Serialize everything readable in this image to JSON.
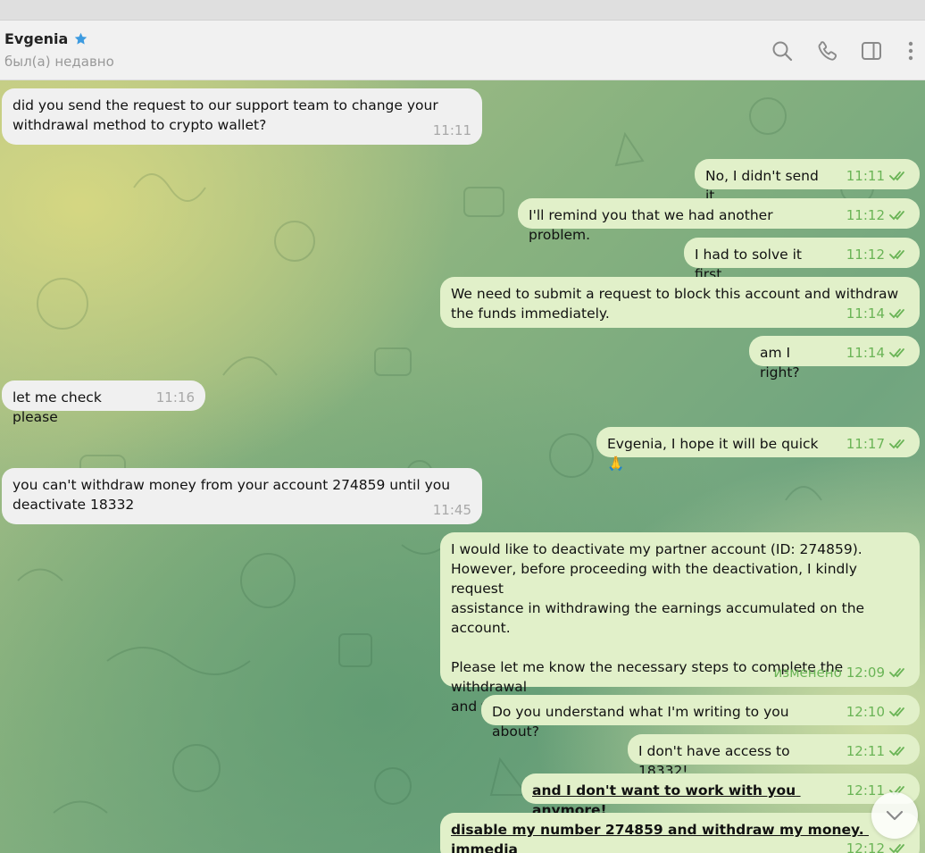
{
  "header": {
    "contact_name": "Evgenia",
    "status": "был(а) недавно",
    "icons": [
      "star-icon",
      "search-icon",
      "phone-icon",
      "sidebar-toggle-icon",
      "more-icon"
    ]
  },
  "messages": [
    {
      "side": "in",
      "text": "did you send the request to our support team to change your\nwithdrawal method to crypto wallet?",
      "time": "11:11"
    },
    {
      "side": "out",
      "text": "No, I didn't send it.",
      "time": "11:11"
    },
    {
      "side": "out",
      "text": "I'll remind you that we had another problem.",
      "time": "11:12"
    },
    {
      "side": "out",
      "text": "I had to solve it first.",
      "time": "11:12"
    },
    {
      "side": "out",
      "text": "We need to submit a request to block this account and withdraw\nthe funds immediately.",
      "time": "11:14"
    },
    {
      "side": "out",
      "text": "am I right?",
      "time": "11:14"
    },
    {
      "side": "in",
      "text": "let me check please",
      "time": "11:16"
    },
    {
      "side": "out",
      "text": "Evgenia, I hope it will be quick 🙏",
      "time": "11:17"
    },
    {
      "side": "in",
      "text": "you can't withdraw money from your account 274859 until you\ndeactivate 18332",
      "time": "11:45"
    },
    {
      "side": "out",
      "text": "I would like to deactivate my partner account (ID: 274859).\nHowever, before proceeding with the deactivation, I kindly request\nassistance in withdrawing the earnings accumulated on the\naccount.\n\nPlease let me know the necessary steps to complete the withdrawal\nand finalize the deactivation process.",
      "edited_label": "изменено",
      "time": "12:09"
    },
    {
      "side": "out",
      "text": "Do you understand what I'm writing to you about?",
      "time": "12:10"
    },
    {
      "side": "out",
      "text": "I don't have access to 18332!",
      "time": "12:11"
    },
    {
      "side": "out",
      "text": "and I don't want to work with you anymore!",
      "time": "12:11",
      "style": "bold-underline"
    },
    {
      "side": "out",
      "text": "disable my number 274859 and withdraw my money. immedia",
      "time": "12:12",
      "style": "bold-underline"
    }
  ],
  "colors": {
    "incoming_bubble": "#f0f0f0",
    "outgoing_bubble": "#e1f0c9",
    "read_tick": "#6ab456",
    "star": "#3d9be0"
  }
}
